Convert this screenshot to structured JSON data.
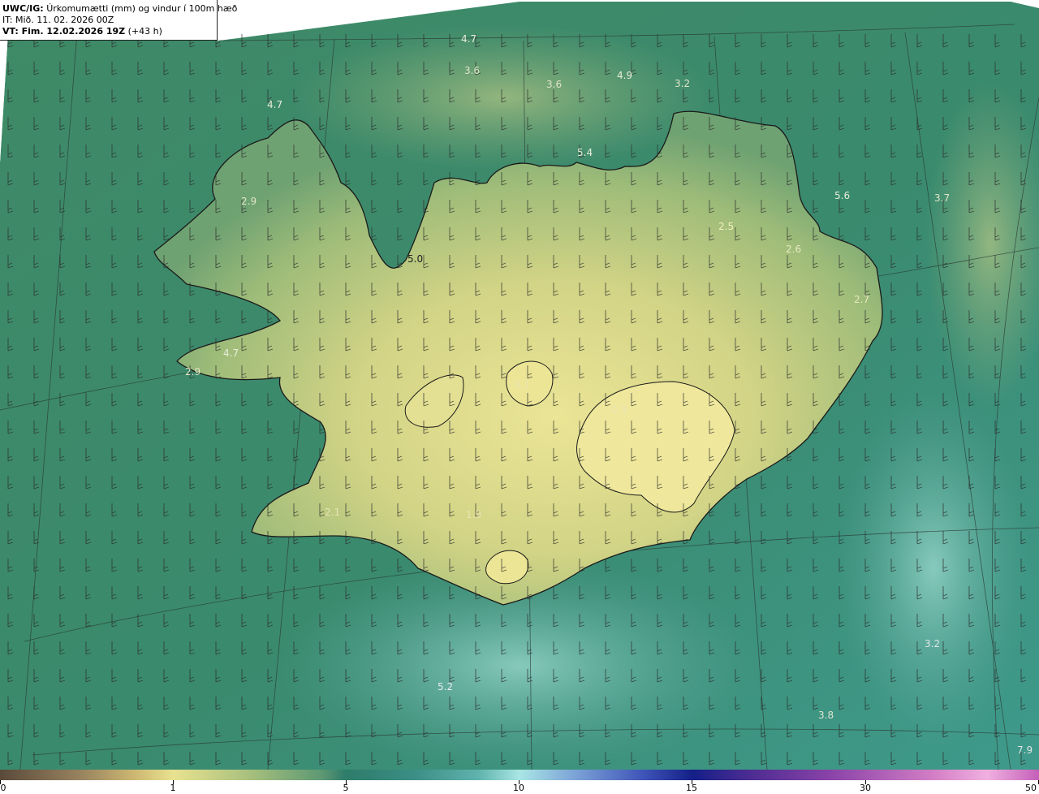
{
  "header": {
    "line1_bold": "UWC/IG:",
    "line1_text": "Úrkomumætti (mm) og vindur í 100m hæð",
    "line2_text": "IT: Mið. 11. 02. 2026 00Z",
    "line3_bold": "VT: Fim. 12.02.2026 19Z",
    "line3_text": "(+43 h)"
  },
  "map_labels": [
    {
      "value": "4.7",
      "color": "#e8ecd8"
    },
    {
      "value": "3.6",
      "color": "#dfe4c8"
    },
    {
      "value": "3.6",
      "color": "#dfe4c8"
    },
    {
      "value": "4.9",
      "color": "#e8ecd8"
    },
    {
      "value": "3.2",
      "color": "#dfe4c8"
    },
    {
      "value": "4.7",
      "color": "#e8ecd8"
    },
    {
      "value": "5.4",
      "color": "#e8ecd8"
    },
    {
      "value": "5.6",
      "color": "#e8ecd8"
    },
    {
      "value": "3.7",
      "color": "#dfe4c8"
    },
    {
      "value": "2.9",
      "color": "#e0e4c4"
    },
    {
      "value": "2.5",
      "color": "#f2efbf"
    },
    {
      "value": "2.6",
      "color": "#e8e8c0"
    },
    {
      "value": "5.0",
      "color": "#222222"
    },
    {
      "value": "2.7",
      "color": "#e8e8c0"
    },
    {
      "value": "4.7",
      "color": "#e8ecd8"
    },
    {
      "value": "2.9",
      "color": "#e0e4c4"
    },
    {
      "value": "4.1",
      "color": "#e8e4b0"
    },
    {
      "value": "0.9",
      "color": "#e8e4b0"
    },
    {
      "value": "2.1",
      "color": "#e8e4b0"
    },
    {
      "value": "1.9",
      "color": "#e8e4b0"
    },
    {
      "value": "3.2",
      "color": "#dfe4e4"
    },
    {
      "value": "5.2",
      "color": "#e8ecec"
    },
    {
      "value": "3.8",
      "color": "#dfe4d0"
    },
    {
      "value": "7.9",
      "color": "#dfe4e4"
    }
  ],
  "colorbar": {
    "ticks": [
      {
        "label": "0",
        "value": 0
      },
      {
        "label": "1",
        "value": 1
      },
      {
        "label": "5",
        "value": 5
      },
      {
        "label": "10",
        "value": 10
      },
      {
        "label": "15",
        "value": 15
      },
      {
        "label": "30",
        "value": 30
      },
      {
        "label": "50",
        "value": 50
      }
    ]
  },
  "colors": {
    "sea_dark": "#2d7d63",
    "sea_light": "#7cc7bf",
    "land_low": "#4e9070",
    "land_high": "#e6e18e",
    "coast": "#1a1a1a"
  }
}
